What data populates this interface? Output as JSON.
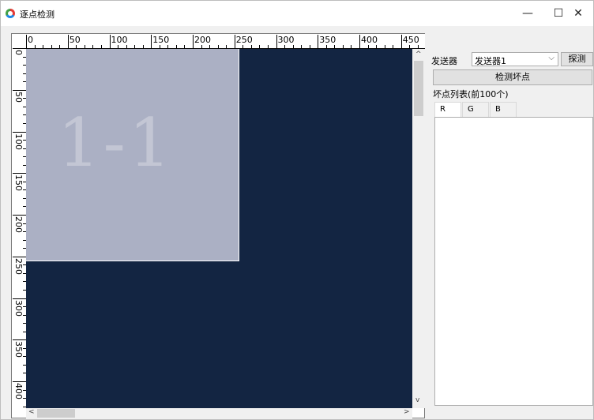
{
  "window": {
    "title": "逐点检测",
    "controls": [
      "—",
      "☐",
      "✕"
    ]
  },
  "ruler": {
    "top_labels": [
      "0",
      "50",
      "100",
      "150",
      "200",
      "250",
      "300",
      "350",
      "400",
      "450"
    ],
    "left_labels": [
      "0",
      "50",
      "100",
      "150",
      "200",
      "250",
      "300",
      "350",
      "400"
    ]
  },
  "canvas": {
    "module_label": "1-1",
    "background_color": "#132542",
    "module_color": "#abb0c4"
  },
  "panel": {
    "sender_label": "发送器",
    "sender_value": "发送器1",
    "probe_button": "探测",
    "detect_button": "检测坏点",
    "list_label": "坏点列表(前100个)",
    "tabs": [
      "R",
      "G",
      "B"
    ]
  }
}
